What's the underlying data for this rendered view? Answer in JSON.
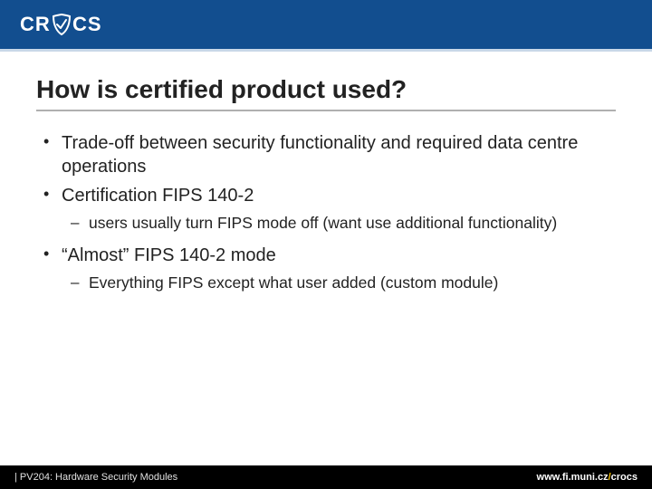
{
  "header": {
    "brand_text": "CROCS",
    "brand_icon": "shield-icon"
  },
  "title": "How is certified product used?",
  "bullets": [
    {
      "text": "Trade-off between security functionality and required data centre operations",
      "children": []
    },
    {
      "text": "Certification FIPS 140-2",
      "children": [
        {
          "text": "users usually turn FIPS mode off (want use additional functionality)"
        }
      ]
    },
    {
      "text": "“Almost” FIPS 140-2 mode",
      "children": [
        {
          "text": "Everything FIPS except what user added (custom module)"
        }
      ]
    }
  ],
  "footer": {
    "left": "| PV204: Hardware Security Modules",
    "right_prefix": "www.fi.muni.cz",
    "right_slash": "/",
    "right_suffix": "crocs"
  }
}
